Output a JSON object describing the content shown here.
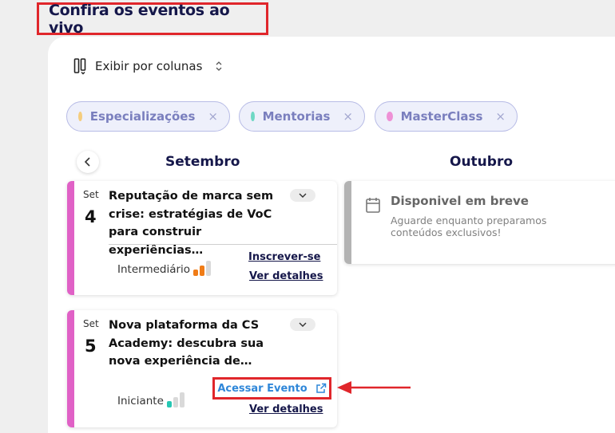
{
  "header": {
    "title": "Confira os eventos ao vivo"
  },
  "toolbar": {
    "view_label": "Exibir por colunas"
  },
  "filters": [
    {
      "label": "Especializações",
      "dot_color": "#f5cd7e",
      "remove": "×"
    },
    {
      "label": "Mentorias",
      "dot_color": "#6fd8c4",
      "remove": "×"
    },
    {
      "label": "MasterClass",
      "dot_color": "#ee91d6",
      "remove": "×"
    }
  ],
  "months": [
    "Setembro",
    "Outubro"
  ],
  "events": [
    {
      "month_abbr": "Set",
      "day": "4",
      "title": "Reputação de marca sem crise: estratégias de VoC para construir experiências…",
      "level": "Intermediário",
      "level_value": 2,
      "level_max": 3,
      "level_color": "#f07c17",
      "primary_action": "Inscrever-se",
      "secondary_action": "Ver detalhes"
    },
    {
      "month_abbr": "Set",
      "day": "5",
      "title": "Nova plataforma da CS Academy: descubra sua nova experiência de…",
      "level": "Iniciante",
      "level_value": 1,
      "level_max": 3,
      "level_color": "#26c7b3",
      "primary_action": "Acessar Evento",
      "secondary_action": "Ver detalhes"
    }
  ],
  "coming_soon": {
    "heading": "Disponivel em breve",
    "text": "Aguarde enquanto preparamos conteúdos exclusivos!"
  },
  "colors": {
    "accent_pink": "#e061c6",
    "highlight_red": "#e0262b",
    "link_blue": "#2f87d9",
    "navy": "#15174a"
  }
}
